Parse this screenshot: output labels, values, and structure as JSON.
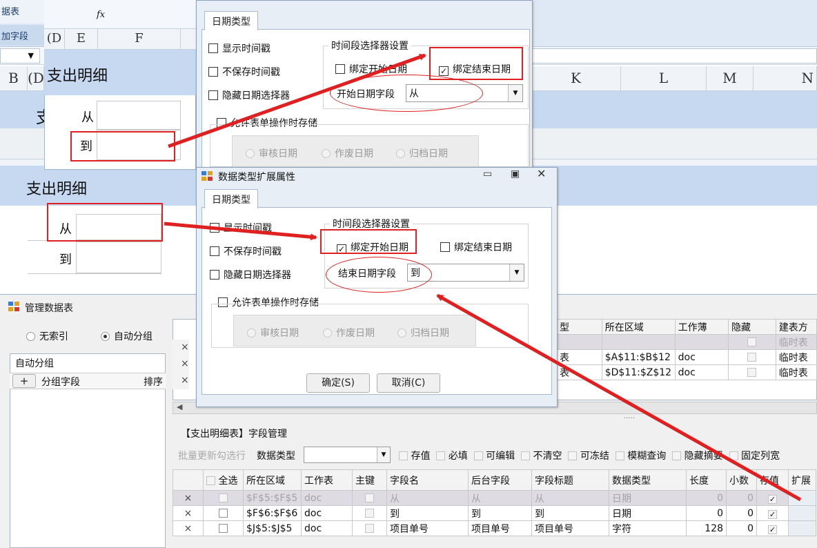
{
  "ribbon": {
    "tab_data_table": "据表",
    "tab_add_field": "加字段",
    "fx": "fx"
  },
  "sheet_top": {
    "columns_left": [
      "(D",
      "E",
      "F"
    ],
    "columns_right": [
      "K",
      "L",
      "M",
      "N"
    ],
    "col_b": "B",
    "col_c": "(D",
    "title": "支出明细",
    "band_char": "支",
    "from": "从",
    "to": "到"
  },
  "sheet_mid": {
    "title": "支出明细",
    "from": "从",
    "to": "到"
  },
  "dialog_top": {
    "tab": "日期类型",
    "opt_show_ts": "显示时间戳",
    "opt_no_save_ts": "不保存时间戳",
    "opt_hide_picker": "隐藏日期选择器",
    "opt_allow_save": "允许表单操作时存储",
    "range_legend": "时间段选择器设置",
    "bind_start": "绑定开始日期",
    "bind_end": "绑定结束日期",
    "field_label": "开始日期字段",
    "field_value": "从",
    "audit": "审核日期",
    "void": "作废日期",
    "archive": "归档日期"
  },
  "dialog_main": {
    "title": "数据类型扩展属性",
    "tab": "日期类型",
    "opt_show_ts": "显示时间戳",
    "opt_no_save_ts": "不保存时间戳",
    "opt_hide_picker": "隐藏日期选择器",
    "opt_allow_save": "允许表单操作时存储",
    "range_legend": "时间段选择器设置",
    "bind_start": "绑定开始日期",
    "bind_end": "绑定结束日期",
    "field_label": "结束日期字段",
    "field_value": "到",
    "audit": "审核日期",
    "void": "作废日期",
    "archive": "归档日期",
    "ok": "确定(S)",
    "cancel": "取消(C)"
  },
  "manager": {
    "title": "管理数据表",
    "radio_no_index": "无索引",
    "radio_auto_group": "自动分组",
    "group_title": "自动分组",
    "group_add": "+",
    "group_field": "分组字段",
    "group_sort": "排序",
    "upper_headers": [
      "型",
      "所在区域",
      "工作薄",
      "隐藏",
      "建表方"
    ],
    "upper_rows": [
      {
        "type": "",
        "range": "",
        "book": "",
        "create": "临时表"
      },
      {
        "type": "表",
        "range": "$A$11:$B$12",
        "book": "doc",
        "create": "临时表"
      },
      {
        "type": "表",
        "range": "$D$11:$Z$12",
        "book": "doc",
        "create": "临时表"
      }
    ],
    "field_section_title": "【支出明细表】字段管理",
    "batch_label": "批量更新勾选行",
    "data_type_label": "数据类型",
    "toggles": [
      "存值",
      "必填",
      "可编辑",
      "不清空",
      "可冻结",
      "模糊查询",
      "隐藏摘要",
      "固定列宽"
    ],
    "lower_headers": [
      "全选",
      "所在区域",
      "工作表",
      "主键",
      "字段名",
      "后台字段",
      "字段标题",
      "数据类型",
      "长度",
      "小数",
      "存值",
      "扩展"
    ],
    "lower_rows": [
      {
        "range": "$F$5:$F$5",
        "sheet": "doc",
        "name": "从",
        "backend": "从",
        "title": "从",
        "dtype": "日期",
        "len": "0",
        "dec": "0"
      },
      {
        "range": "$F$6:$F$6",
        "sheet": "doc",
        "name": "到",
        "backend": "到",
        "title": "到",
        "dtype": "日期",
        "len": "0",
        "dec": "0"
      },
      {
        "range": "$J$5:$J$5",
        "sheet": "doc",
        "name": "项目单号",
        "backend": "项目单号",
        "title": "项目单号",
        "dtype": "字符",
        "len": "128",
        "dec": "0"
      }
    ],
    "row_x": "×",
    "splitter_dots": "....."
  },
  "colors": {
    "accent_red": "#e02020",
    "band_blue": "#c6d9f0"
  }
}
